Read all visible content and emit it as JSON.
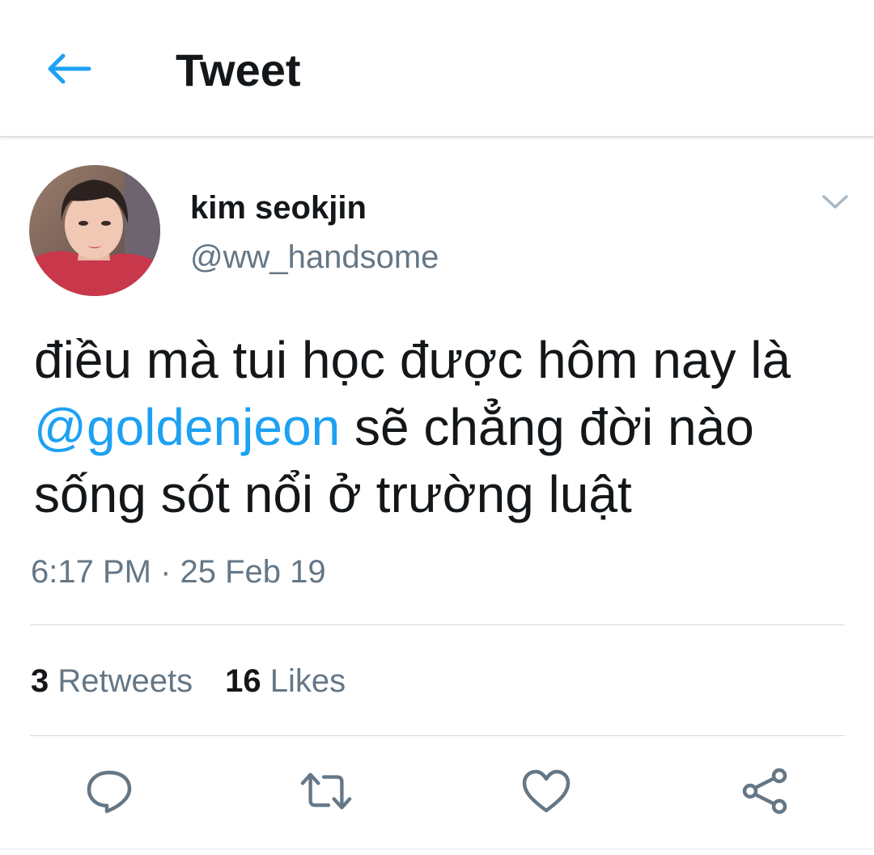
{
  "header": {
    "back_icon": "arrow-left-icon",
    "title": "Tweet"
  },
  "tweet": {
    "author": {
      "display_name": "kim seokjin",
      "handle": "@ww_handsome",
      "avatar": "profile-photo"
    },
    "menu_icon": "chevron-down-icon",
    "text": {
      "before_mention": "điều mà tui học được hôm nay là ",
      "mention": "@goldenjeon",
      "after_mention": " sẽ chẳng đời nào sống sót nổi ở trường luật"
    },
    "timestamp": "6:17 PM · 25 Feb 19",
    "stats": {
      "retweets_count": "3",
      "retweets_label": "Retweets",
      "likes_count": "16",
      "likes_label": "Likes"
    },
    "actions": [
      {
        "name": "reply",
        "icon": "reply-icon"
      },
      {
        "name": "retweet",
        "icon": "retweet-icon"
      },
      {
        "name": "like",
        "icon": "heart-icon"
      },
      {
        "name": "share",
        "icon": "share-icon"
      }
    ]
  },
  "colors": {
    "accent": "#1da1f2",
    "text_primary": "#14171a",
    "text_secondary": "#657786",
    "icon_gray": "#657786",
    "divider": "#d6dbdf"
  }
}
